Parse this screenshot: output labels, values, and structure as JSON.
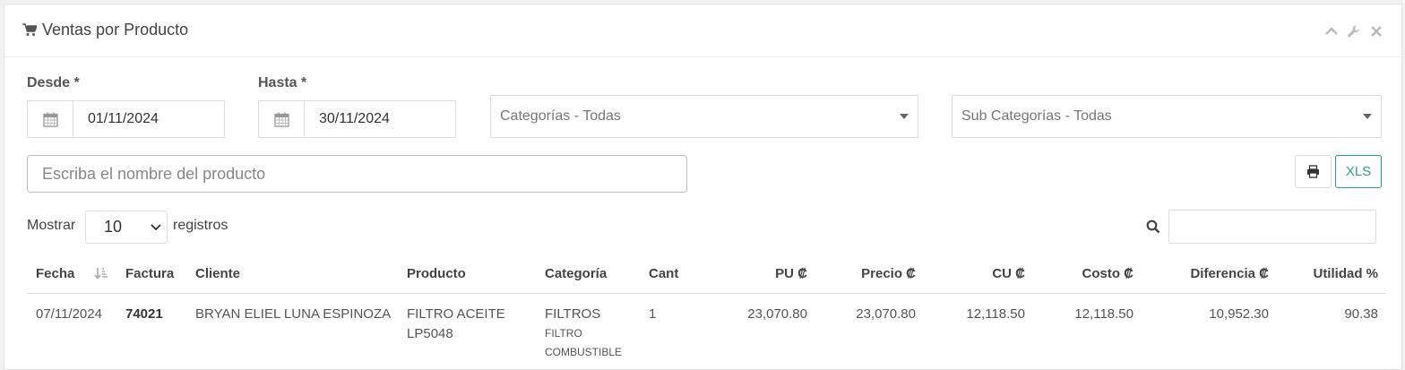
{
  "panel": {
    "title": "Ventas por Producto",
    "icons": [
      "shopping-cart-icon",
      "chevron-up-icon",
      "wrench-icon",
      "close-icon"
    ]
  },
  "filters": {
    "desde_label": "Desde *",
    "desde_value": "01/11/2024",
    "hasta_label": "Hasta *",
    "hasta_value": "30/11/2024",
    "categorias": "Categorías - Todas",
    "subcategorias": "Sub Categorías - Todas",
    "product_placeholder": "Escriba el nombre del producto",
    "xls_label": "XLS"
  },
  "table_controls": {
    "show_label": "Mostrar",
    "page_length": "10",
    "records_label": "registros",
    "search_value": ""
  },
  "table": {
    "columns": [
      "Fecha",
      "Factura",
      "Cliente",
      "Producto",
      "Categoría",
      "Cant",
      "PU ₡",
      "Precio ₡",
      "CU ₡",
      "Costo ₡",
      "Diferencia ₡",
      "Utilidad %"
    ],
    "rows": [
      {
        "fecha": "07/11/2024",
        "factura": "74021",
        "cliente": "BRYAN ELIEL LUNA ESPINOZA",
        "producto": "FILTRO ACEITE LP5048",
        "categoria": "FILTROS",
        "subcategoria": "FILTRO COMBUSTIBLE",
        "cant": "1",
        "pu": "23,070.80",
        "precio": "23,070.80",
        "cu": "12,118.50",
        "costo": "12,118.50",
        "diferencia": "10,952.30",
        "utilidad": "90.38"
      }
    ]
  }
}
